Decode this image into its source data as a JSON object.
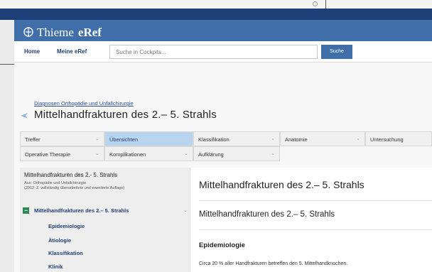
{
  "header": {
    "brand": "Thieme",
    "product": "eRef"
  },
  "nav": {
    "home_label": "Home",
    "my_eref_label": "Meine eRef",
    "search_placeholder": "Suche in Cockpits...",
    "search_button_label": "Suche"
  },
  "page": {
    "breadcrumb": "Diagnosen Orthopädie und Unfallchirurgie",
    "title": "Mittelhandfrakturen des 2.– 5. Strahls"
  },
  "tabs": [
    {
      "label": "Treffer",
      "active": false
    },
    {
      "label": "Übersichten",
      "active": true
    },
    {
      "label": "Klassifikation",
      "active": false
    },
    {
      "label": "Anatomie",
      "active": false
    },
    {
      "label": "Untersuchung",
      "active": false
    },
    {
      "label": "Operative Therapie",
      "active": false
    },
    {
      "label": "Komplikationen",
      "active": false
    },
    {
      "label": "Aufklärung",
      "active": false
    }
  ],
  "left_panel": {
    "title": "Mittelhandfrakturen des 2.- 5. Strahls",
    "source_line1": "Aus: Orthopädie und Unfallchirurgie",
    "source_line2": "(2012: 2. vollständig überarbeitete und erweiterte Auflage)",
    "node_label": "Mittelhandfrakturen des 2.– 5. Strahls",
    "items": [
      "Epidemiologie",
      "Ätiologie",
      "Klassifikation",
      "Klinik"
    ]
  },
  "content": {
    "heading1": "Mittelhandfrakturen des 2.– 5. Strahls",
    "heading2": "Mittelhandfrakturen des 2.– 5. Strahls",
    "section_heading": "Epidemiologie",
    "body_text": "Circa 20 % aller Handfrakturen betreffen den 5. Mittelhandknochen."
  },
  "icons": {
    "logo": "thieme-emblem-icon",
    "title": "plane-icon",
    "node": "minus-square-icon",
    "tab_chevron": "chevron-down-icon"
  },
  "colors": {
    "brand_blue": "#3f6ea8",
    "dark_blue": "#1f3f78",
    "active_tab": "#b9d4ee",
    "node_green": "#2e8b57"
  }
}
